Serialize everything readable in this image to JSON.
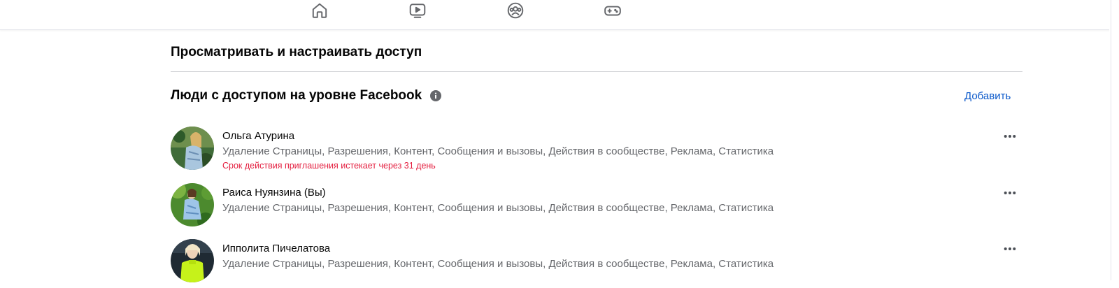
{
  "nav": {
    "icons": [
      "home-icon",
      "watch-icon",
      "groups-icon",
      "gaming-icon"
    ]
  },
  "section": {
    "title": "Просматривать и настраивать доступ"
  },
  "people_section": {
    "title": "Люди с доступом на уровне Facebook",
    "add_label": "Добавить"
  },
  "people": [
    {
      "name": "Ольга Атурина",
      "permissions": "Удаление Страницы, Разрешения, Контент, Сообщения и вызовы, Действия в сообществе, Реклама, Статистика",
      "note": "Срок действия приглашения истекает через 31 день"
    },
    {
      "name": "Раиса Нуянзина (Вы)",
      "permissions": "Удаление Страницы, Разрешения, Контент, Сообщения и вызовы, Действия в сообществе, Реклама, Статистика",
      "note": ""
    },
    {
      "name": "Ипполита Пичелатова",
      "permissions": "Удаление Страницы, Разрешения, Контент, Сообщения и вызовы, Действия в сообществе, Реклама, Статистика",
      "note": ""
    }
  ],
  "colors": {
    "link": "#0a58ca",
    "secondary_text": "#65676b",
    "warning_text": "#e41e3f",
    "icon": "#65676b"
  }
}
